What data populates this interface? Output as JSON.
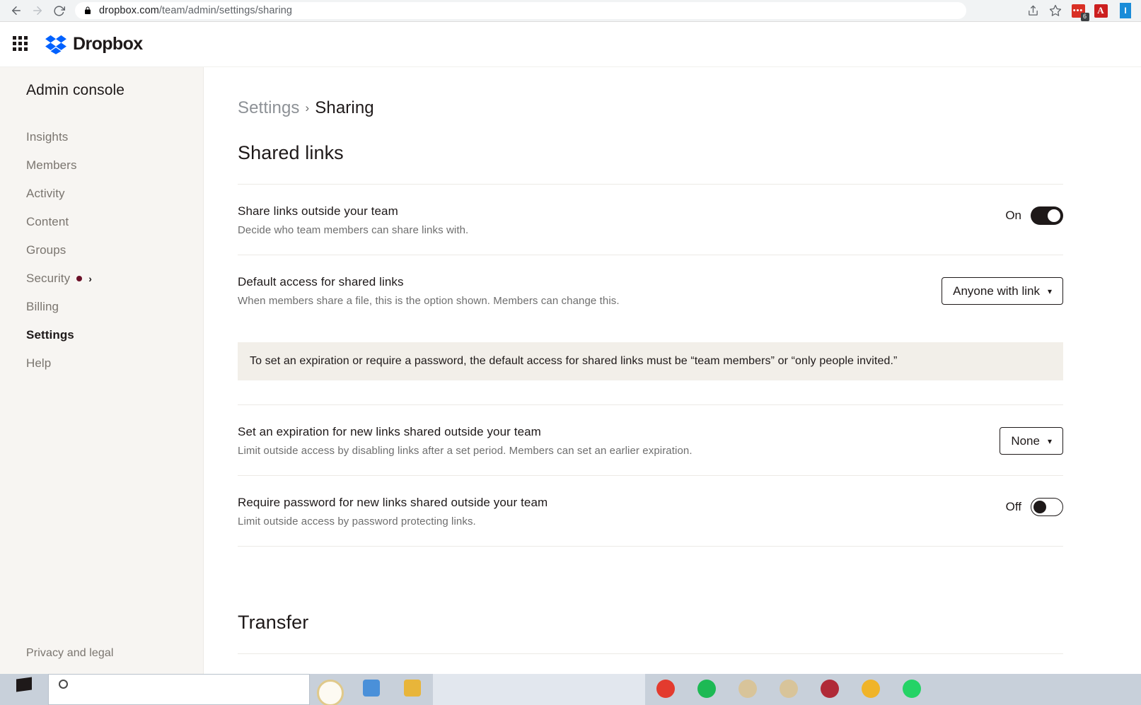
{
  "browser": {
    "url_prefix": "dropbox.com",
    "url_path": "/team/admin/settings/sharing",
    "back_icon": "back-arrow-icon",
    "forward_icon": "forward-arrow-icon",
    "reload_icon": "reload-icon",
    "lock_icon": "lock-icon",
    "share_icon": "share-icon",
    "bookmark_icon": "star-icon",
    "extension_badge_count": "6",
    "pdf_label": "A",
    "blue_ext_label": "I"
  },
  "header": {
    "apps_icon": "apps-grid-icon",
    "logo_icon": "dropbox-logo-icon",
    "brand": "Dropbox"
  },
  "sidebar": {
    "title": "Admin console",
    "items": [
      {
        "label": "Insights",
        "active": false
      },
      {
        "label": "Members",
        "active": false
      },
      {
        "label": "Activity",
        "active": false
      },
      {
        "label": "Content",
        "active": false
      },
      {
        "label": "Groups",
        "active": false
      },
      {
        "label": "Security",
        "active": false,
        "badge_dot": true,
        "chevron": "›"
      },
      {
        "label": "Billing",
        "active": false
      },
      {
        "label": "Settings",
        "active": true
      },
      {
        "label": "Help",
        "active": false
      }
    ],
    "footer": "Privacy and legal"
  },
  "breadcrumb": {
    "parent": "Settings",
    "separator": "›",
    "current": "Sharing"
  },
  "main": {
    "section_title": "Shared links",
    "rows": [
      {
        "label": "Share links outside your team",
        "desc": "Decide who team members can share links with.",
        "control_type": "toggle",
        "toggle_state": "On"
      },
      {
        "label": "Default access for shared links",
        "desc": "When members share a file, this is the option shown. Members can change this.",
        "control_type": "select",
        "select_value": "Anyone with link"
      },
      {
        "label": "Set an expiration for new links shared outside your team",
        "desc": "Limit outside access by disabling links after a set period. Members can set an earlier expiration.",
        "control_type": "select",
        "select_value": "None"
      },
      {
        "label": "Require password for new links shared outside your team",
        "desc": "Limit outside access by password protecting links.",
        "control_type": "toggle",
        "toggle_state": "Off"
      }
    ],
    "banner": "To set an expiration or require a password, the default access for shared links must be “team members” or “only people invited.”",
    "transfer_title": "Transfer"
  },
  "colors": {
    "brand_blue": "#0061FF",
    "sidebar_bg": "#f7f5f2",
    "banner_bg": "#f2efe9",
    "badge_dot": "#6b1028",
    "toggle_on": "#1e1919"
  },
  "taskbar": {
    "start_icon": "windows-start-icon",
    "search_icon": "search-icon",
    "apps": [
      {
        "name": "taskview-icon",
        "color": "#4a90d9"
      },
      {
        "name": "folder-icon",
        "color": "#e8b53a"
      },
      {
        "name": "opera-icon",
        "color": "#e33b2e"
      },
      {
        "name": "youtube-icon",
        "color": "#e33b2e"
      },
      {
        "name": "spotify-icon",
        "color": "#1db954"
      },
      {
        "name": "edge-icon",
        "color": "#d8c49a"
      },
      {
        "name": "edge-beta-icon",
        "color": "#d8c49a"
      },
      {
        "name": "app-icon",
        "color": "#b02a37"
      },
      {
        "name": "notes-icon",
        "color": "#f0b429"
      },
      {
        "name": "whatsapp-icon",
        "color": "#25d366"
      }
    ]
  }
}
